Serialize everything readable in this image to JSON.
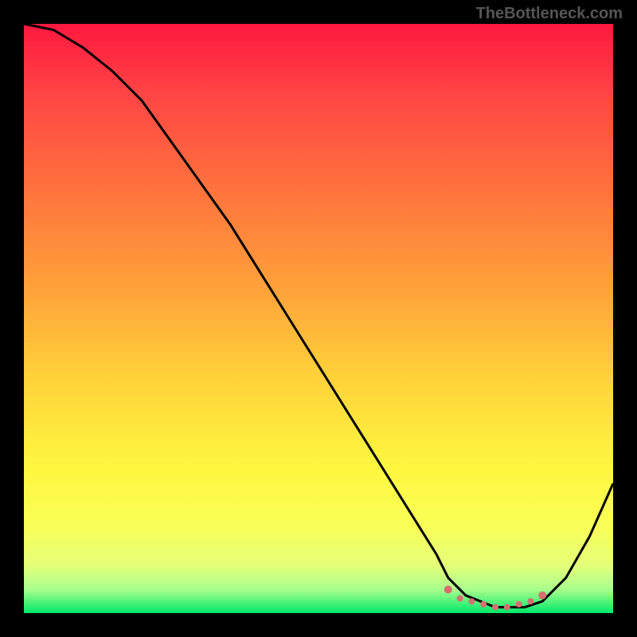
{
  "watermark": "TheBottleneck.com",
  "chart_data": {
    "type": "line",
    "title": "",
    "xlabel": "",
    "ylabel": "",
    "xlim": [
      0,
      100
    ],
    "ylim": [
      0,
      100
    ],
    "series": [
      {
        "name": "bottleneck-curve",
        "x": [
          0,
          5,
          10,
          15,
          20,
          25,
          30,
          35,
          40,
          45,
          50,
          55,
          60,
          65,
          70,
          72,
          75,
          80,
          85,
          88,
          92,
          96,
          100
        ],
        "y": [
          100,
          99,
          96,
          92,
          87,
          80,
          73,
          66,
          58,
          50,
          42,
          34,
          26,
          18,
          10,
          6,
          3,
          1,
          1,
          2,
          6,
          13,
          22
        ]
      }
    ],
    "markers": {
      "name": "highlight-band",
      "color": "#d47070",
      "x": [
        72,
        74,
        76,
        78,
        80,
        82,
        84,
        86,
        88
      ],
      "y": [
        4,
        2.5,
        2,
        1.5,
        1,
        1,
        1.5,
        2,
        3
      ]
    }
  }
}
